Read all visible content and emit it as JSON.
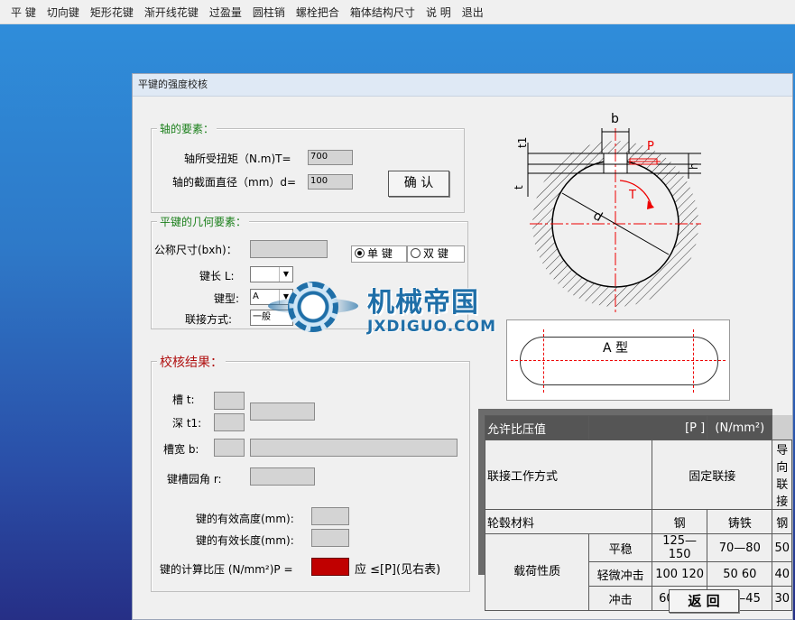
{
  "menu": [
    "平 键",
    "切向键",
    "矩形花键",
    "渐开线花键",
    "过盈量",
    "圆柱销",
    "螺栓把合",
    "箱体结构尺寸",
    "说 明",
    "退出"
  ],
  "window": {
    "title": "平键的强度校核"
  },
  "shaft": {
    "caption": "轴的要素：",
    "torque_label": "轴所受扭矩（N.m)T=",
    "torque_value": "700",
    "diameter_label": "轴的截面直径（mm）d=",
    "diameter_value": "100",
    "confirm_label": "确 认"
  },
  "key": {
    "caption": "平键的几何要素：",
    "nominal_label": "公称尺寸(bxh)：",
    "length_label": "键长 L:",
    "type_label": "键型:",
    "type_value": "A",
    "connect_label": "联接方式:",
    "connect_value": "一般",
    "single_label": "单 键",
    "double_label": "双 键"
  },
  "result": {
    "caption": "校核结果：",
    "groove_t": "槽 t:",
    "depth_t1": "深 t1:",
    "width_b": "槽宽 b:",
    "radius_r": "键槽园角 r:",
    "eff_height": "键的有效高度(mm):",
    "eff_length": "键的有效长度(mm):",
    "pressure_label": "键的计算比压 (N/mm²)P =",
    "pressure_suffix": "应 ≤[P](见右表)",
    "pressure_color": "#c00000"
  },
  "diagram": {
    "b": "b",
    "t1": "t1",
    "t": "t",
    "h": "h",
    "P": "P",
    "T": "T",
    "d": "d",
    "type_label": "A 型"
  },
  "watermark": {
    "brand": "机械帝国",
    "domain": "JXDIGUO.COM"
  },
  "table": {
    "header": [
      "允许比压值",
      "[P ]",
      "(N/mm²)"
    ],
    "row2": [
      "联接工作方式",
      "固定联接",
      "导向联接"
    ],
    "row3": [
      "轮毂材料",
      "钢",
      "铸铁",
      "钢"
    ],
    "group": "载荷性质",
    "rows": [
      [
        "平稳",
        "125—150",
        "70—80",
        "50"
      ],
      [
        "轻微冲击",
        "100 120",
        "50 60",
        "40"
      ],
      [
        "冲击",
        "60—90",
        "30—45",
        "30"
      ]
    ]
  },
  "back_label": "返 回"
}
